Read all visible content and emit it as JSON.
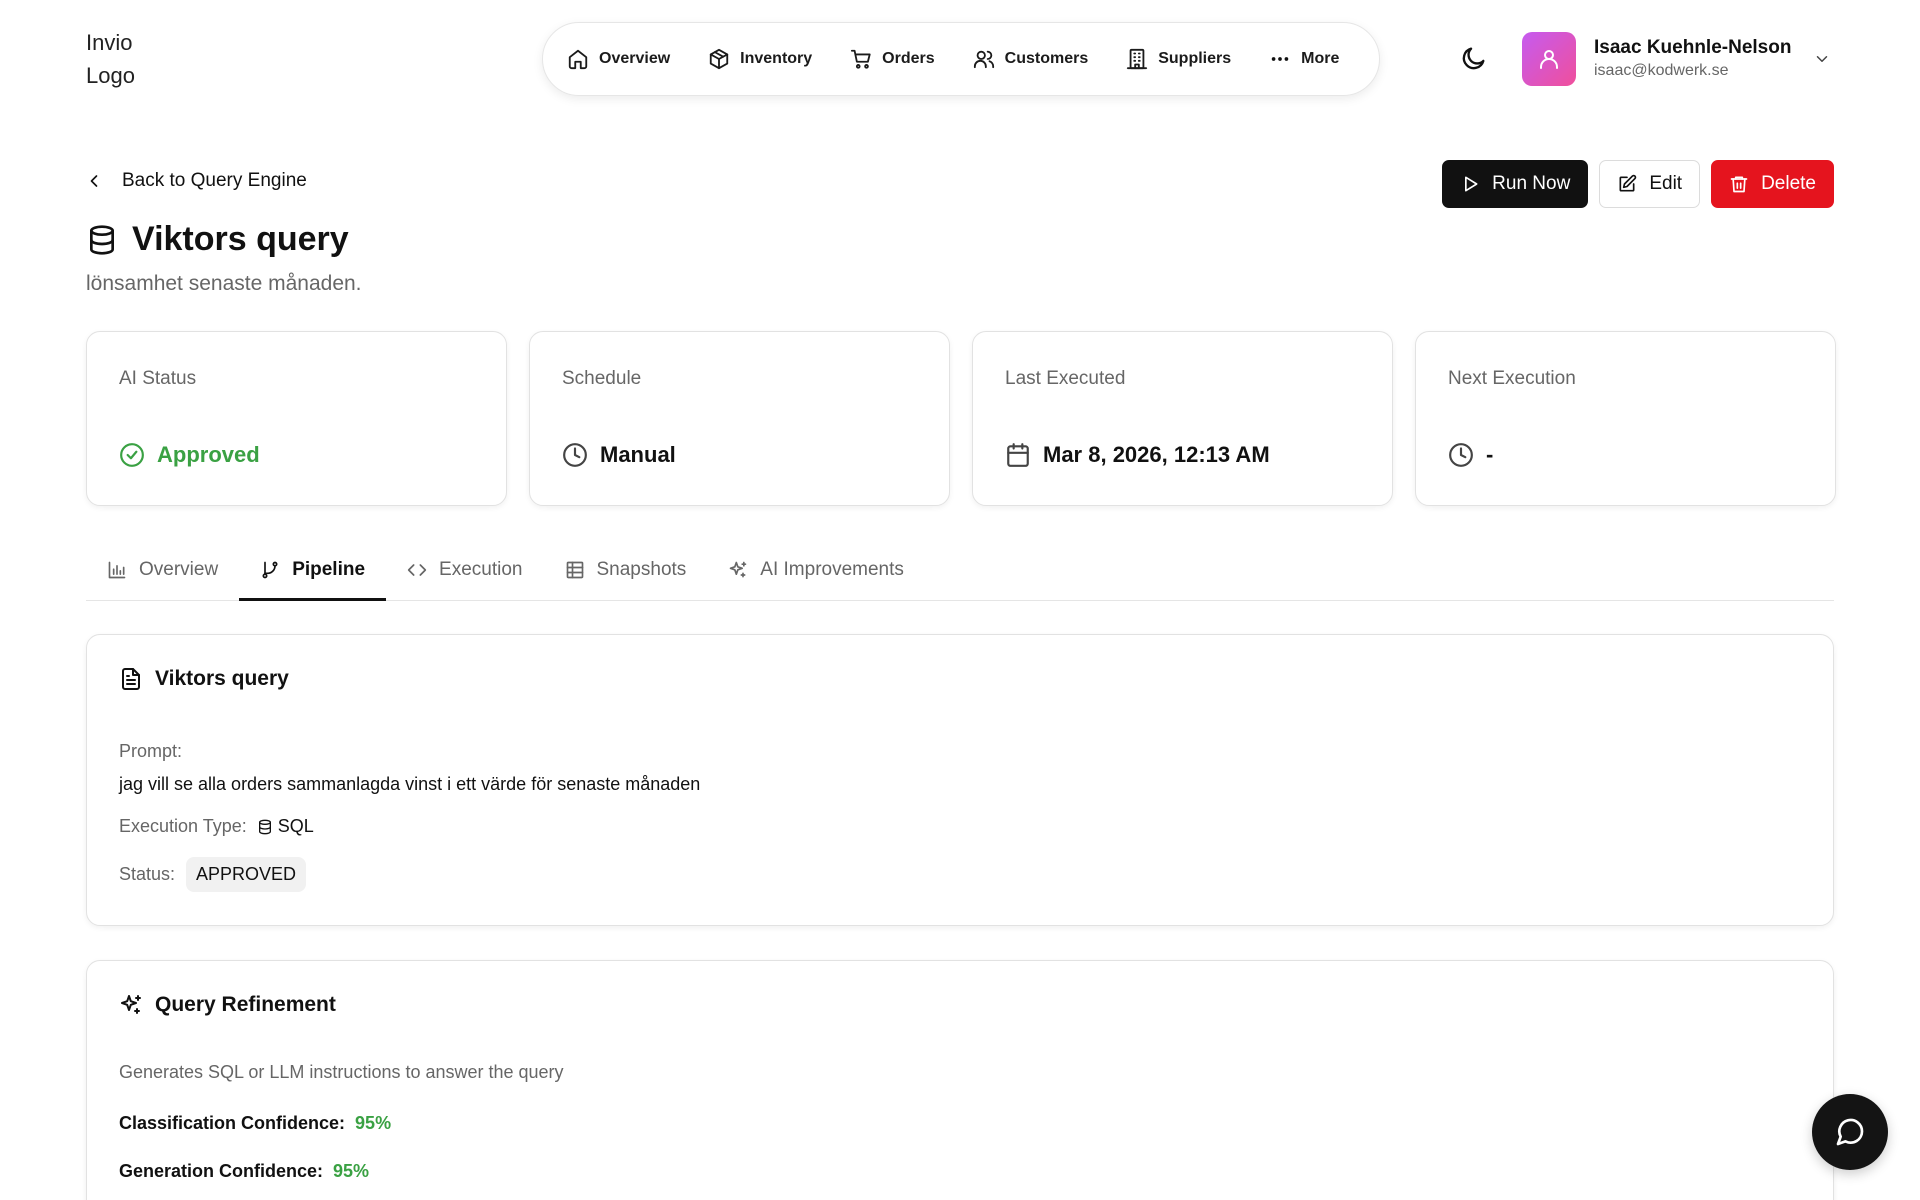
{
  "header": {
    "logo_alt": "Invio Logo",
    "nav": [
      {
        "label": "Overview",
        "icon": "home-icon"
      },
      {
        "label": "Inventory",
        "icon": "package-icon"
      },
      {
        "label": "Orders",
        "icon": "cart-icon"
      },
      {
        "label": "Customers",
        "icon": "users-icon"
      },
      {
        "label": "Suppliers",
        "icon": "building-icon"
      },
      {
        "label": "More",
        "icon": "ellipsis-icon"
      }
    ],
    "user": {
      "name": "Isaac Kuehnle-Nelson",
      "email": "isaac@kodwerk.se"
    }
  },
  "page": {
    "back_label": "Back to Query Engine",
    "title": "Viktors query",
    "subtitle": "lönsamhet senaste månaden.",
    "actions": {
      "run": "Run Now",
      "edit": "Edit",
      "delete": "Delete"
    }
  },
  "cards": [
    {
      "label": "AI Status",
      "value": "Approved",
      "icon": "check-circle-icon"
    },
    {
      "label": "Schedule",
      "value": "Manual",
      "icon": "clock-icon"
    },
    {
      "label": "Last Executed",
      "value": "Mar 8, 2026, 12:13 AM",
      "icon": "calendar-icon"
    },
    {
      "label": "Next Execution",
      "value": "-",
      "icon": "clock-icon"
    }
  ],
  "tabs": [
    {
      "label": "Overview",
      "icon": "bar-chart-icon",
      "active": false
    },
    {
      "label": "Pipeline",
      "icon": "git-branch-icon",
      "active": true
    },
    {
      "label": "Execution",
      "icon": "code-icon",
      "active": false
    },
    {
      "label": "Snapshots",
      "icon": "table-icon",
      "active": false
    },
    {
      "label": "AI Improvements",
      "icon": "sparkles-icon",
      "active": false
    }
  ],
  "query_panel": {
    "title": "Viktors query",
    "prompt_label": "Prompt:",
    "prompt": "jag vill se alla orders sammanlagda vinst i ett värde för senaste månaden",
    "exec_type_label": "Execution Type:",
    "exec_type": "SQL",
    "status_label": "Status:",
    "status": "APPROVED"
  },
  "refinement_panel": {
    "title": "Query Refinement",
    "description": "Generates SQL or LLM instructions to answer the query",
    "classification_label": "Classification Confidence:",
    "classification_value": "95%",
    "generation_label": "Generation Confidence:",
    "generation_value": "95%"
  },
  "colors": {
    "accent_green": "#3aa143",
    "danger": "#e5141e",
    "primary": "#111111"
  }
}
